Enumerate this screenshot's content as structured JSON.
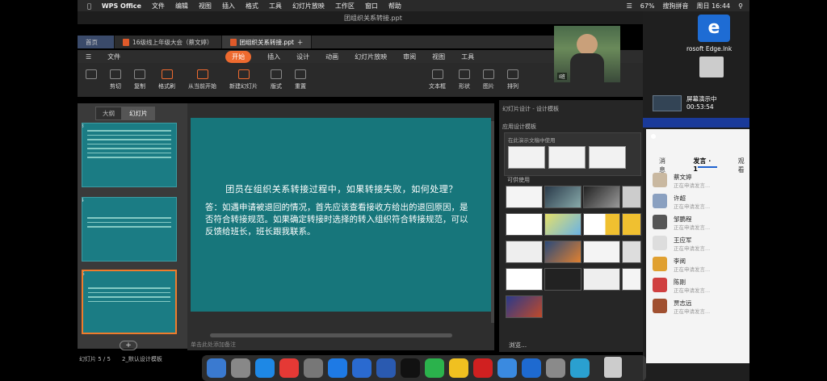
{
  "menubar": {
    "app_name": "WPS Office",
    "items": [
      "文件",
      "编辑",
      "视图",
      "插入",
      "格式",
      "工具",
      "幻灯片放映",
      "工作区",
      "窗口",
      "帮助"
    ],
    "battery": "67%",
    "input_method": "搜狗拼音",
    "clock": "周日 16:44"
  },
  "window": {
    "doc_title": "团组织关系转接.ppt"
  },
  "tabs": [
    {
      "label": "首页"
    },
    {
      "label": "16级线上年级大会（蔡文婷）"
    },
    {
      "label": "团组织关系转接.ppt"
    }
  ],
  "ribbon": {
    "file": "文件",
    "tabs": [
      "开始",
      "插入",
      "设计",
      "动画",
      "幻灯片放映",
      "审阅",
      "视图",
      "工具"
    ],
    "tools": [
      "剪切",
      "复制",
      "格式刷",
      "从当前开始",
      "新建幻灯片",
      "版式",
      "重置",
      "文本框",
      "形状",
      "图片",
      "排列"
    ]
  },
  "left_panel": {
    "tab_outline": "大纲",
    "tab_slides": "幻灯片",
    "slide_numbers": [
      "3",
      "4",
      "5"
    ],
    "add_label": "+",
    "status_slide": "幻灯片 5 / 5",
    "status_template": "2_默认设计模板"
  },
  "slide": {
    "question": "团员在组织关系转接过程中，如果转接失败，如何处理？",
    "answer": "答：如遇申请被退回的情况，首先应该查看接收方给出的退回原因，是否符合转接规范。如果确定转接时选择的转入组织符合转接规范，可以反馈给班长，班长跟我联系。",
    "notes_placeholder": "单击此处添加备注"
  },
  "design_pane": {
    "header": "幻灯片设计 - 设计模板",
    "applied_label": "应用设计模板",
    "in_use_label": "在此演示文稿中使用",
    "available_label": "可供使用",
    "browse_label": "浏览..."
  },
  "video": {
    "tag": "Ⅰ班"
  },
  "side_panel": {
    "edge_label": "rosoft Edge.lnk",
    "screen_share_title": "屏幕演示中",
    "screen_share_time": "00:53:54",
    "tab_messages": "消息",
    "tab_speaking": "发言 · 1",
    "tab_watching": "观看",
    "members": [
      {
        "name": "蔡文婷",
        "status": "正在申请发言..."
      },
      {
        "name": "许超",
        "status": "正在申请发言..."
      },
      {
        "name": "邹鹏程",
        "status": "正在申请发言..."
      },
      {
        "name": "王应军",
        "status": "正在申请发言..."
      },
      {
        "name": "李阅",
        "status": "正在申请发言..."
      },
      {
        "name": "陈刚",
        "status": "正在申请发言..."
      },
      {
        "name": "贾志远",
        "status": "正在申请发言..."
      }
    ]
  },
  "colors": {
    "slide_bg": "#17767b",
    "accent_orange": "#ee6a2f",
    "chat_bg": "#f4f4f4"
  }
}
